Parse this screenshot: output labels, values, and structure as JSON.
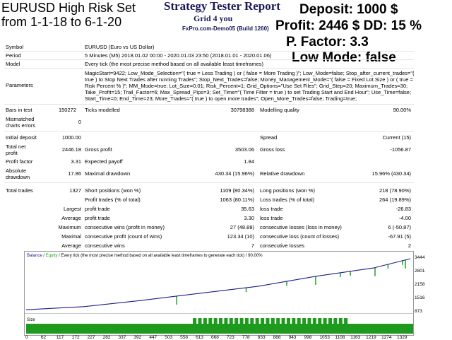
{
  "header": {
    "left_line1": "EURUSD High Risk Set",
    "left_line2": "from 1-1-18 to 6-1-20",
    "report_title": "Strategy Tester Report",
    "report_subtitle": "Grid 4 you",
    "report_small": "FxPro.com-Demo05 (Build 1260)",
    "deposit": "Deposit: 1000 $",
    "profit_dd": "Profit: 2446 $ DD: 15 %",
    "pfactor": "P. Factor: 3.3",
    "lowmode": "Low Mode: false"
  },
  "info": {
    "symbol_label": "Symbol",
    "symbol_value": "EURUSD (Euro vs US Dollar)",
    "period_label": "Period",
    "period_value": "5 Minutes (M5) 2018.01.02 00:00 - 2020.01.03 23:50 (2018.01.01 - 2020.01.06)",
    "model_label": "Model",
    "model_value": "Every tick (the most precise method based on all available least timeframes)",
    "parameters_label": "Parameters",
    "parameters_value": "MagicStart=9422; Low_Mode_Selection=\"( true = Less Trading ) or ( false = More Trading )\"; Low_Mode=false; Stop_after_current_trades=\"( true ) to Stop Next Trades after running Trades\"; Stop_Next_Trades=false; Money_Management_Mode=\"( false = Fixed Lot Size ) or ( true = Risk Percent % )\"; MM_Mode=true; Lot_Size=0.01; Risk_Percent=1; Grid_Options=\"Use Set Files\"; Grid_Step=20; Maximum_Trades=30; Take_Profit=15; Trail_Factor=6; Max_Spread_Pips=3; Set_Time=\"( Time Filter = true ) to set Trading Start and End Hour\"; Use_Time=false; Start_Time=0; End_Time=23; More_Trades=\"( true ) to open more trades\"; Open_More_Trades=false; Trading=true;"
  },
  "stats": {
    "bars_label": "Bars in test",
    "bars_value": "150272",
    "ticks_label": "Ticks modelled",
    "ticks_value": "30798388",
    "quality_label": "Modelling quality",
    "quality_value": "90.00%",
    "mismatch_label1": "Mismatched",
    "mismatch_label2": "charts errors",
    "mismatch_value": "0",
    "init_label": "Initial deposit",
    "init_value": "1000.00",
    "spread_label": "Spread",
    "spread_value": "Current (15)",
    "net_label1": "Total net",
    "net_label2": "profit",
    "net_value": "2446.18",
    "gross_profit_label": "Gross profit",
    "gross_profit_value": "3503.06",
    "gross_loss_label": "Gross loss",
    "gross_loss_value": "-1056.87",
    "pf_label": "Profit factor",
    "pf_value": "3.31",
    "payoff_label": "Expected payoff",
    "payoff_value": "1.84",
    "abs_dd_label1": "Absolute",
    "abs_dd_label2": "drawdown",
    "abs_dd_value": "17.86",
    "max_dd_label": "Maximal drawdown",
    "max_dd_value": "430.34 (15.96%)",
    "rel_dd_label": "Relative drawdown",
    "rel_dd_value": "15.96% (430.34)",
    "total_trades_label": "Total trades",
    "total_trades_value": "1327",
    "short_label": "Short positions (won %)",
    "short_value": "1109 (80.34%)",
    "long_label": "Long positions (won %)",
    "long_value": "218 (78.90%)",
    "ptrades_label": "Profit trades (% of total)",
    "ptrades_value": "1063 (80.11%)",
    "ltrades_label": "Loss trades (% of total)",
    "ltrades_value": "264 (19.89%)",
    "largest_label": "Largest",
    "largest_profit_label": "profit trade",
    "largest_profit_value": "35.63",
    "largest_loss_label": "loss trade",
    "largest_loss_value": "-26.83",
    "average_label": "Average",
    "avg_profit_label": "profit trade",
    "avg_profit_value": "3.30",
    "avg_loss_label": "loss trade",
    "avg_loss_value": "-4.00",
    "maximum_label": "Maximum",
    "max_cw_label": "consecutive wins (profit in money)",
    "max_cw_value": "27 (48.88)",
    "max_cl_label": "consecutive losses (loss in money)",
    "max_cl_value": "6 (-50.87)",
    "maximal_label": "Maximal",
    "maximal_cp_label": "consecutive profit (count of wins)",
    "maximal_cp_value": "123.34 (10)",
    "maximal_cl_label": "consecutive loss (count of losses)",
    "maximal_cl_value": "-67.91 (5)",
    "avg2_label": "Average",
    "avg_cw_label": "consecutive wins",
    "avg_cw_value": "7",
    "avg_cl_label": "consecutive losses",
    "avg_cl_value": "2"
  },
  "chart": {
    "legend_balance": "Balance",
    "legend_sep": " / ",
    "legend_equity": "Equity",
    "legend_rest": " / Every tick (the most precise method based on all available least timeframes to generate each tick) / 90.00%",
    "size_label": "Size",
    "balance_color": "#1c1c8c",
    "equity_color": "#1aa61a"
  },
  "chart_data": {
    "type": "line",
    "series": [
      {
        "name": "Balance",
        "x": [
          0,
          200,
          400,
          600,
          800,
          1000,
          1200,
          1327
        ],
        "values": [
          1000,
          1150,
          1450,
          1790,
          2120,
          2600,
          3000,
          3444
        ]
      }
    ],
    "yticks": [
      "3444",
      "2801",
      "2158",
      "1516",
      "873"
    ],
    "xticks": [
      "0",
      "62",
      "117",
      "172",
      "227",
      "282",
      "337",
      "392",
      "447",
      "503",
      "558",
      "613",
      "668",
      "723",
      "778",
      "833",
      "888",
      "943",
      "998",
      "1053",
      "1108",
      "1163",
      "1219",
      "1274",
      "1329"
    ]
  }
}
